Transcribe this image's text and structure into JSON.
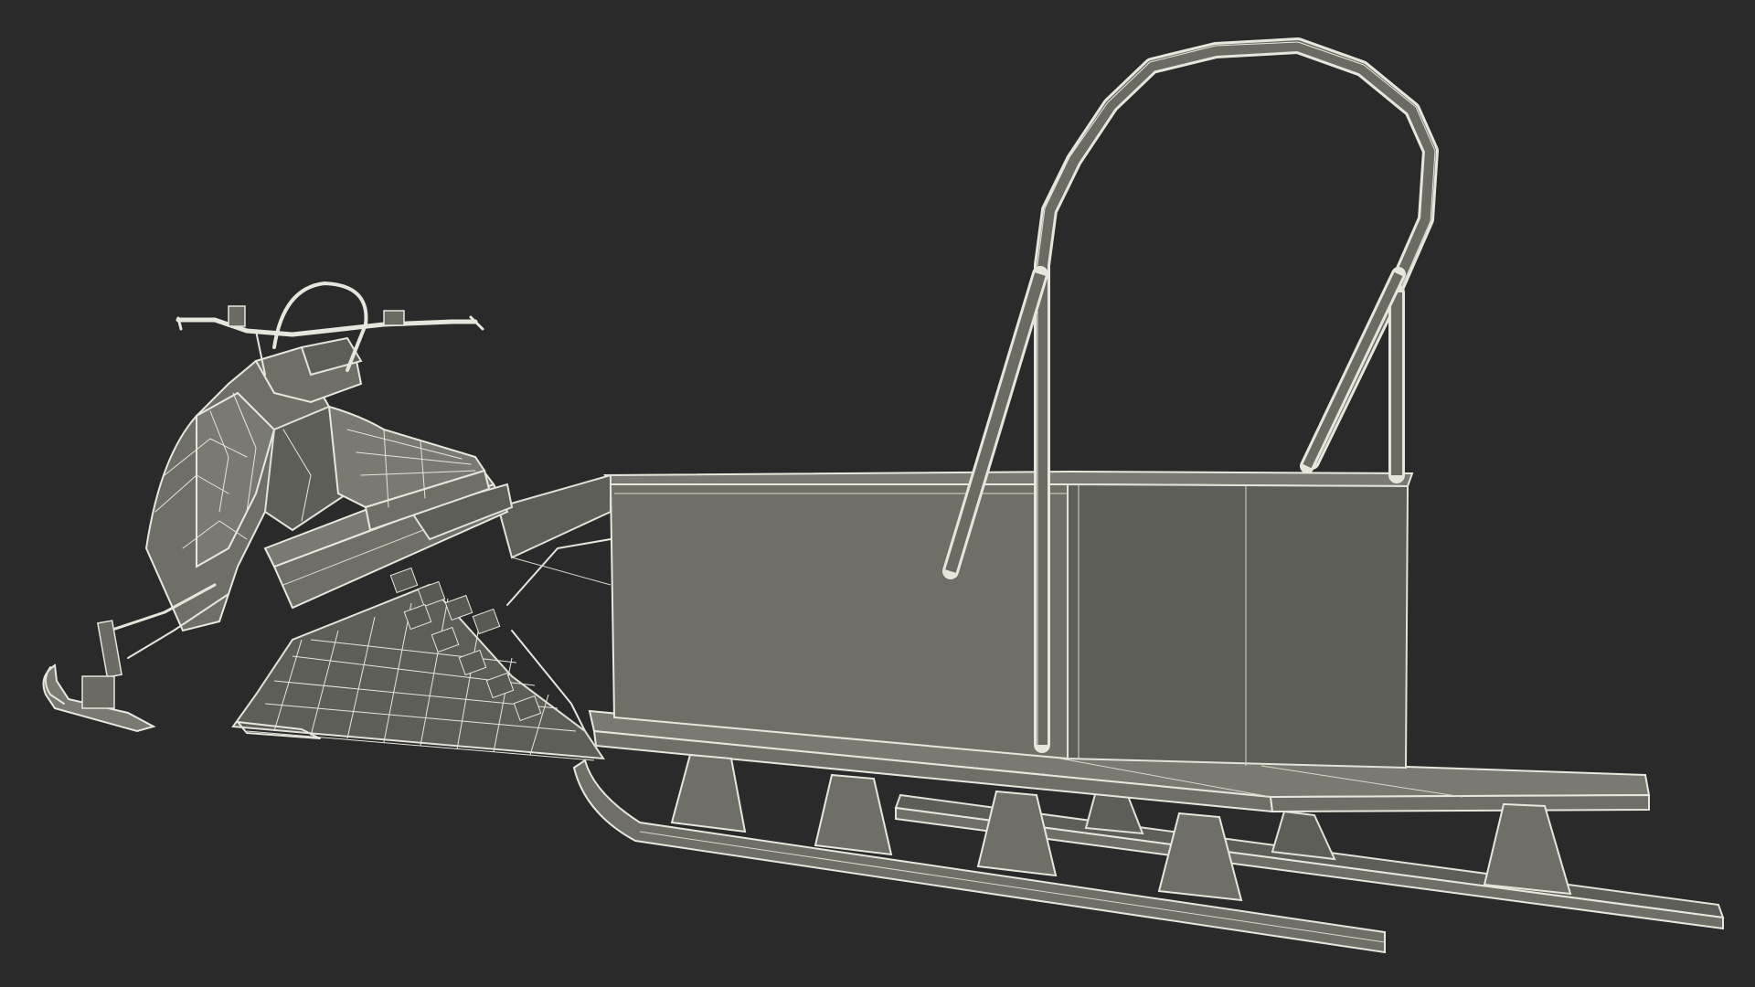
{
  "scene": {
    "subject": "snowmobile-with-cargo-sled",
    "render_style": "wireframe-over-clay",
    "colors": {
      "background": "#2a2a2a",
      "wire": "#e6e6dc",
      "clay_face": "#6f6f68",
      "clay_face_dark": "#5e5e58"
    }
  }
}
